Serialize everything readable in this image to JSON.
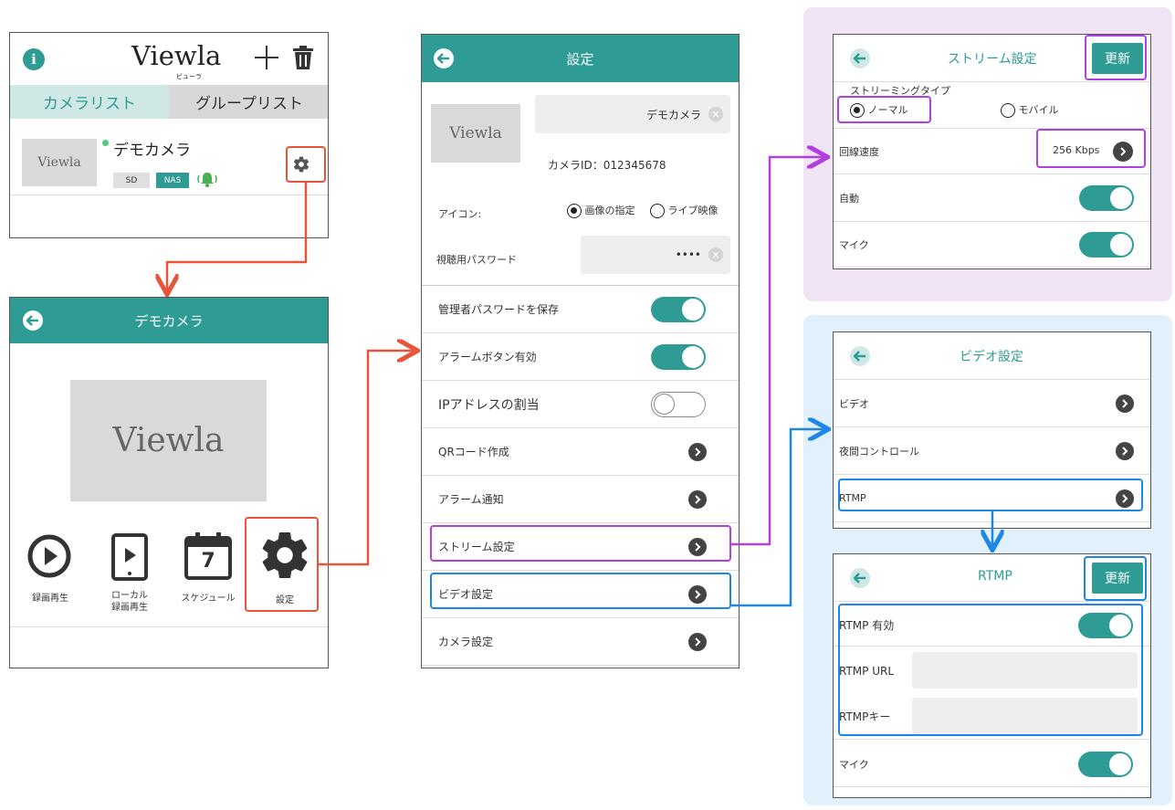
{
  "colors": {
    "teal": "#2e9c95",
    "red": "#e9523b",
    "purple": "#b23fe0",
    "blue": "#1d87e6",
    "purple_bg": "#f1e4f5",
    "blue_bg": "#e2f0fb"
  },
  "camera_list": {
    "brand": "Viewla",
    "brand_sub": "ビューラ",
    "tabs": [
      "カメラリスト",
      "グループリスト"
    ],
    "camera_name": "デモカメラ",
    "badges": [
      "SD",
      "NAS"
    ],
    "thumb_text": "Viewla",
    "icons": [
      "info-icon",
      "plus-icon",
      "trash-icon",
      "gear-icon",
      "bell-icon"
    ]
  },
  "camera_menu": {
    "title": "デモカメラ",
    "thumb_text": "Viewla",
    "actions": [
      {
        "label": "録画再生",
        "icon": "play-circle-icon"
      },
      {
        "label": "ローカル\n録画再生",
        "icon": "tablet-play-icon"
      },
      {
        "label": "スケジュール",
        "icon": "calendar-icon",
        "day": "7"
      },
      {
        "label": "設定",
        "icon": "gear-icon"
      }
    ]
  },
  "settings": {
    "title": "設定",
    "thumb_text": "Viewla",
    "camera_name_value": "デモカメラ",
    "camera_id": "カメラID：012345678",
    "icon_label": "アイコン:",
    "icon_options": [
      "画像の指定",
      "ライブ映像"
    ],
    "password_label": "視聴用パスワード",
    "password_value": "••••",
    "rows": [
      {
        "label": "管理者パスワードを保存",
        "control": "toggle-on"
      },
      {
        "label": "アラームボタン有効",
        "control": "toggle-on"
      },
      {
        "label": "IPアドレスの割当",
        "control": "toggle-off"
      },
      {
        "label": "QRコード作成",
        "control": "chevron"
      },
      {
        "label": "アラーム通知",
        "control": "chevron"
      },
      {
        "label": "ストリーム設定",
        "control": "chevron"
      },
      {
        "label": "ビデオ設定",
        "control": "chevron"
      },
      {
        "label": "カメラ設定",
        "control": "chevron"
      }
    ]
  },
  "stream_settings": {
    "title": "ストリーム設定",
    "update": "更新",
    "type_label": "ストリーミングタイプ",
    "types": [
      "ノーマル",
      "モバイル"
    ],
    "speed_label": "回線速度",
    "speed_value": "256 Kbps",
    "auto_label": "自動",
    "mic_label": "マイク"
  },
  "video_settings": {
    "title": "ビデオ設定",
    "rows": [
      "ビデオ",
      "夜間コントロール",
      "RTMP"
    ]
  },
  "rtmp": {
    "title": "RTMP",
    "update": "更新",
    "enable_label": "RTMP 有効",
    "url_label": "RTMP URL",
    "key_label": "RTMPキー",
    "mic_label": "マイク"
  }
}
